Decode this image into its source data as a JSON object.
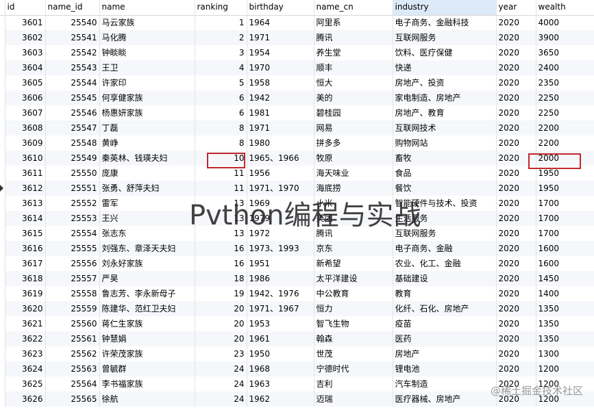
{
  "columns": [
    {
      "key": "id",
      "label": "id",
      "align": "num"
    },
    {
      "key": "name_id",
      "label": "name_id",
      "align": "num"
    },
    {
      "key": "name",
      "label": "name",
      "align": "txt"
    },
    {
      "key": "ranking",
      "label": "ranking",
      "align": "num"
    },
    {
      "key": "birthday",
      "label": "birthday",
      "align": "txt"
    },
    {
      "key": "name_cn",
      "label": "name_cn",
      "align": "txt"
    },
    {
      "key": "industry",
      "label": "industry",
      "align": "txt",
      "sorted": true
    },
    {
      "key": "year",
      "label": "year",
      "align": "txt"
    },
    {
      "key": "wealth",
      "label": "wealth",
      "align": "txt"
    }
  ],
  "current_row_id": "3612",
  "rows": [
    [
      "3601",
      "25540",
      "马云家族",
      "1",
      "1964",
      "阿里系",
      "电子商务、金融科技",
      "2020",
      "4000"
    ],
    [
      "3602",
      "25541",
      "马化腾",
      "2",
      "1971",
      "腾讯",
      "互联网服务",
      "2020",
      "3900"
    ],
    [
      "3603",
      "25542",
      "钟睒睒",
      "3",
      "1954",
      "养生堂",
      "饮料、医疗保健",
      "2020",
      "3650"
    ],
    [
      "3604",
      "25543",
      "王卫",
      "4",
      "1970",
      "顺丰",
      "快递",
      "2020",
      "2400"
    ],
    [
      "3605",
      "25544",
      "许家印",
      "5",
      "1958",
      "恒大",
      "房地产、投资",
      "2020",
      "2350"
    ],
    [
      "3606",
      "25545",
      "何享健家族",
      "6",
      "1942",
      "美的",
      "家电制造、房地产",
      "2020",
      "2250"
    ],
    [
      "3607",
      "25546",
      "杨惠妍家族",
      "6",
      "1981",
      "碧桂园",
      "房地产、教育",
      "2020",
      "2250"
    ],
    [
      "3608",
      "25547",
      "丁磊",
      "8",
      "1971",
      "网易",
      "互联网技术",
      "2020",
      "2200"
    ],
    [
      "3609",
      "25548",
      "黄峥",
      "8",
      "1980",
      "拼多多",
      "购物网站",
      "2020",
      "2200"
    ],
    [
      "3610",
      "25549",
      "秦英林、钱瑛夫妇",
      "10",
      "1965、1966",
      "牧原",
      "畜牧",
      "2020",
      "2000"
    ],
    [
      "3611",
      "25550",
      "庞康",
      "11",
      "1956",
      "海天味业",
      "食品",
      "2020",
      "1950"
    ],
    [
      "3612",
      "25551",
      "张勇、舒萍夫妇",
      "11",
      "1971、1970",
      "海底捞",
      "餐饮",
      "2020",
      "1950"
    ],
    [
      "3613",
      "25552",
      "雷军",
      "13",
      "1969",
      "小米",
      "智能硬件与技术、投资",
      "2020",
      "1700"
    ],
    [
      "3614",
      "25553",
      "王兴",
      "13",
      "1979",
      "美团",
      "生活服务",
      "2020",
      "1700"
    ],
    [
      "3615",
      "25554",
      "张志东",
      "13",
      "1972",
      "腾讯",
      "互联网服务",
      "2020",
      "1700"
    ],
    [
      "3616",
      "25555",
      "刘强东、章泽天夫妇",
      "16",
      "1973、1993",
      "京东",
      "电子商务、金融",
      "2020",
      "1600"
    ],
    [
      "3617",
      "25556",
      "刘永好家族",
      "16",
      "1951",
      "新希望",
      "农业、化工、金融",
      "2020",
      "1600"
    ],
    [
      "3618",
      "25557",
      "严昊",
      "18",
      "1986",
      "太平洋建设",
      "基础建设",
      "2020",
      "1450"
    ],
    [
      "3619",
      "25558",
      "鲁志芳、李永新母子",
      "19",
      "1942、1976",
      "中公教育",
      "教育",
      "2020",
      "1400"
    ],
    [
      "3620",
      "25559",
      "陈建华、范红卫夫妇",
      "20",
      "1971、1967",
      "恒力",
      "化纤、石化、房地产",
      "2020",
      "1350"
    ],
    [
      "3621",
      "25560",
      "蒋仁生家族",
      "20",
      "1953",
      "智飞生物",
      "疫苗",
      "2020",
      "1350"
    ],
    [
      "3622",
      "25561",
      "钟慧娟",
      "20",
      "1961",
      "翰森",
      "医药",
      "2020",
      "1350"
    ],
    [
      "3623",
      "25562",
      "许荣茂家族",
      "23",
      "1950",
      "世茂",
      "房地产",
      "2020",
      "1300"
    ],
    [
      "3624",
      "25563",
      "曾毓群",
      "24",
      "1968",
      "宁德时代",
      "锂电池",
      "2020",
      "1200"
    ],
    [
      "3625",
      "25564",
      "李书福家族",
      "24",
      "1963",
      "吉利",
      "汽车制造",
      "2020",
      "1200"
    ],
    [
      "3626",
      "25565",
      "徐航",
      "24",
      "1962",
      "迈瑞",
      "医疗器械、房地产",
      "2020",
      "1200"
    ]
  ],
  "watermark": "Pvthon编程与实战",
  "source_mark": "@稀土掘金技术社区",
  "colors": {
    "highlight_box": "#c0282d",
    "sorted_header": "#dce9f7",
    "alt_row": "#f5f7fa"
  }
}
